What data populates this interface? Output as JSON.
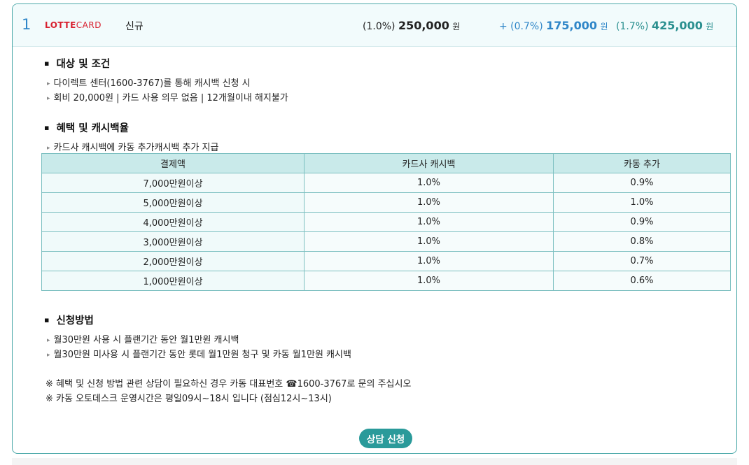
{
  "header": {
    "rank": "1",
    "logo_brand": "LOTTE",
    "logo_card": "CARD",
    "type": "신규",
    "amount1": {
      "pct": "(1.0%)",
      "value": "250,000",
      "unit": "원"
    },
    "amount2": {
      "pct": "+ (0.7%)",
      "value": "175,000",
      "unit": "원"
    },
    "amount3": {
      "pct": "(1.7%)",
      "value": "425,000",
      "unit": "원"
    }
  },
  "conditions": {
    "title": "대상 및 조건",
    "lines": [
      "다이렉트 센터(1600-3767)를 통해 캐시백 신청 시",
      "회비 20,000원 | 카드 사용 의무 없음 | 12개월이내 해지불가"
    ]
  },
  "benefits": {
    "title": "혜택 및 캐시백율",
    "lines": [
      "카드사 캐시백에 카동 추가캐시백 추가 지급"
    ],
    "table": {
      "headers": [
        "결제액",
        "카드사 캐시백",
        "카동 추가"
      ],
      "rows": [
        [
          "7,000만원이상",
          "1.0%",
          "0.9%"
        ],
        [
          "5,000만원이상",
          "1.0%",
          "1.0%"
        ],
        [
          "4,000만원이상",
          "1.0%",
          "0.9%"
        ],
        [
          "3,000만원이상",
          "1.0%",
          "0.8%"
        ],
        [
          "2,000만원이상",
          "1.0%",
          "0.7%"
        ],
        [
          "1,000만원이상",
          "1.0%",
          "0.6%"
        ]
      ]
    }
  },
  "apply": {
    "title": "신청방법",
    "lines": [
      "월30만원 사용 시 플랜기간 동안 월1만원 캐시백",
      "월30만원 미사용 시 플랜기간 동안 롯데 월1만원 청구 및 카동 월1만원 캐시백"
    ]
  },
  "notes": [
    "※ 혜택 및 신청 방법 관련 상담이 필요하신 경우 카동 대표번호 ☎1600-3767로 문의 주십시오",
    "※ 카동 오토데스크 운영시간은 평일09시~18시 입니다 (점심12시~13시)"
  ],
  "consult_button": "상담 신청"
}
